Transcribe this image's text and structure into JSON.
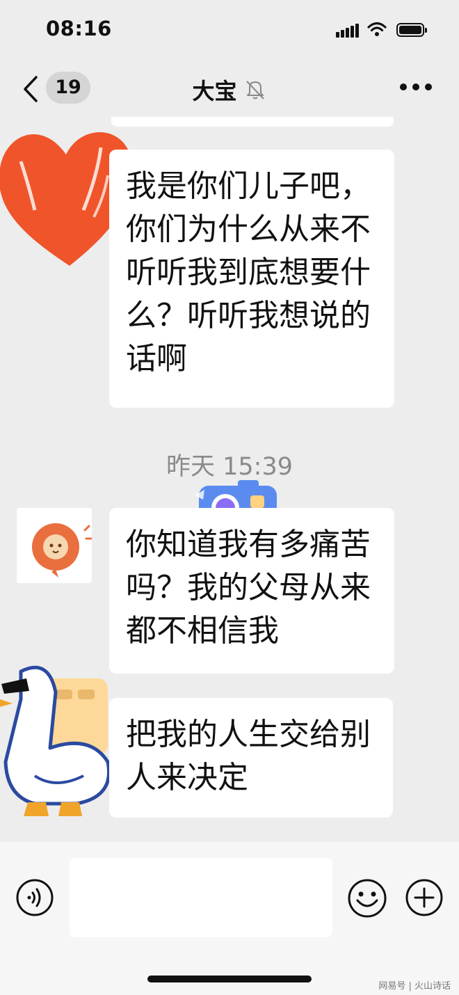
{
  "status_bar": {
    "time": "08:16",
    "signal_icon": "signal-icon",
    "wifi_icon": "wifi-icon",
    "battery_icon": "battery-icon"
  },
  "header": {
    "back_icon": "chevron-left-icon",
    "unread_count": "19",
    "title": "大宝",
    "mute_icon": "bell-off-icon",
    "more_icon": "more-dots-icon"
  },
  "messages": [
    {
      "side": "right",
      "text": "我是你们儿子吧，你们为什么从来不听听我到底想要什么？听听我想说的话啊"
    },
    {
      "type": "timestamp",
      "text": "昨天 15:39"
    },
    {
      "side": "left",
      "text": "你知道我有多痛苦吗？我的父母从来都不相信我"
    },
    {
      "side": "left",
      "text": "把我的人生交给别人来决定"
    }
  ],
  "input_bar": {
    "voice_icon": "voice-icon",
    "input_value": "",
    "emoji_icon": "emoji-icon",
    "plus_icon": "plus-icon"
  },
  "stickers": [
    "heart-sticker",
    "camera-sticker",
    "duck-sticker"
  ],
  "watermark": "网易号 | 火山诗话",
  "colors": {
    "background": "#ededed",
    "bubble": "#ffffff",
    "heart": "#f0542a",
    "camera": "#5b8bef",
    "badge": "#d5d5d5"
  }
}
